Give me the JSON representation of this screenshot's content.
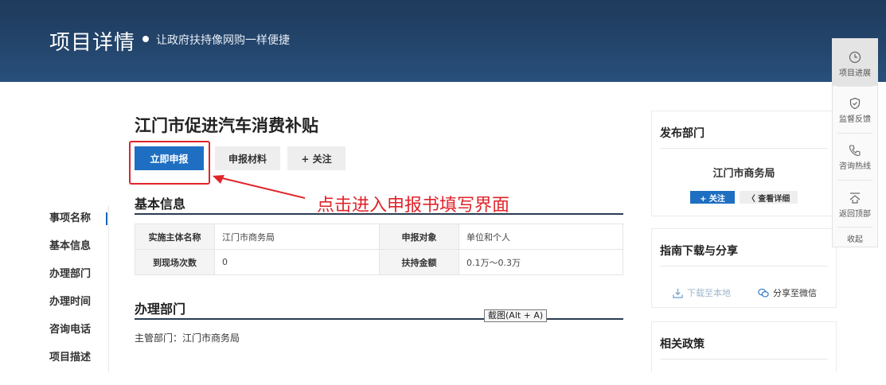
{
  "header": {
    "title": "项目详情",
    "subtitle": "让政府扶持像网购一样便捷"
  },
  "left_nav": {
    "items": [
      {
        "label": "事项名称",
        "active": true
      },
      {
        "label": "基本信息",
        "active": false
      },
      {
        "label": "办理部门",
        "active": false
      },
      {
        "label": "办理时间",
        "active": false
      },
      {
        "label": "咨询电话",
        "active": false
      },
      {
        "label": "项目描述",
        "active": false
      }
    ]
  },
  "main": {
    "title": "江门市促进汽车消费补贴",
    "buttons": {
      "apply": "立即申报",
      "materials": "申报材料",
      "follow": "+ 关注"
    },
    "annotation": "点击进入申报书填写界面",
    "basic_info": {
      "title": "基本信息",
      "rows": [
        {
          "label1": "实施主体名称",
          "value1": "江门市商务局",
          "label2": "申报对象",
          "value2": "单位和个人"
        },
        {
          "label1": "到现场次数",
          "value1": "0",
          "label2": "扶持金额",
          "value2": "0.1万～0.3万"
        }
      ]
    },
    "department": {
      "title": "办理部门",
      "line": "主管部门：江门市商务局"
    },
    "tooltip": "截图(Alt + A)"
  },
  "right": {
    "publisher": {
      "title": "发布部门",
      "name": "江门市商务局",
      "follow": "+ 关注",
      "details": "〈 查看详细"
    },
    "guide": {
      "title": "指南下载与分享",
      "download": "下载至本地",
      "share": "分享至微信"
    },
    "policy": {
      "title": "相关政策"
    }
  },
  "float_bar": {
    "items": [
      {
        "label": "项目进展",
        "icon": "clock-icon"
      },
      {
        "label": "监督反馈",
        "icon": "shield-icon"
      },
      {
        "label": "咨询热线",
        "icon": "phone-icon"
      },
      {
        "label": "返回顶部",
        "icon": "back-to-top-icon"
      }
    ],
    "collapse": "收起"
  },
  "colors": {
    "header": "#24466d",
    "primary": "#1e6fc2",
    "annotation": "#e0242a"
  }
}
